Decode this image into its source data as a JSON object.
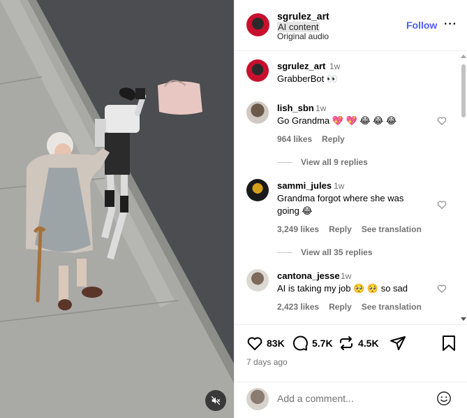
{
  "post": {
    "username": "sgrulez_art",
    "label": "AI content",
    "audio": "Original audio",
    "follow_label": "Follow",
    "more_label": "···"
  },
  "comments": [
    {
      "username": "sgrulez_art",
      "time": "1w",
      "text": "GrabberBot 👀"
    },
    {
      "username": "lish_sbn",
      "time": "1w",
      "text": "Go Grandma 💖 💖 😂 😂 😂",
      "likes": "964 likes",
      "reply": "Reply",
      "view_replies": "View all 9 replies"
    },
    {
      "username": "sammi_jules",
      "time": "1w",
      "text_line1": "Grandma forgot where she was",
      "text_line2": "going 😂",
      "likes": "3,249 likes",
      "reply": "Reply",
      "translate": "See translation",
      "view_replies": "View all 35 replies"
    },
    {
      "username": "cantona_jesse",
      "time": "1w",
      "text": "AI is taking my job 🥺 🥺 so sad",
      "likes": "2,423 likes",
      "reply": "Reply",
      "translate": "See translation"
    }
  ],
  "actions": {
    "likes": "83K",
    "comments": "5.7K",
    "reposts": "4.5K"
  },
  "posted": "7 days ago",
  "add_comment": {
    "placeholder": "Add a comment..."
  },
  "colors": {
    "follow": "#4e5bf2",
    "heart_emoji": "#e8336f",
    "muted_text": "#737373"
  },
  "icons": [
    "mute-icon",
    "heart-icon",
    "comment-icon",
    "repost-icon",
    "share-icon",
    "bookmark-icon",
    "emoji-icon",
    "more-icon"
  ]
}
